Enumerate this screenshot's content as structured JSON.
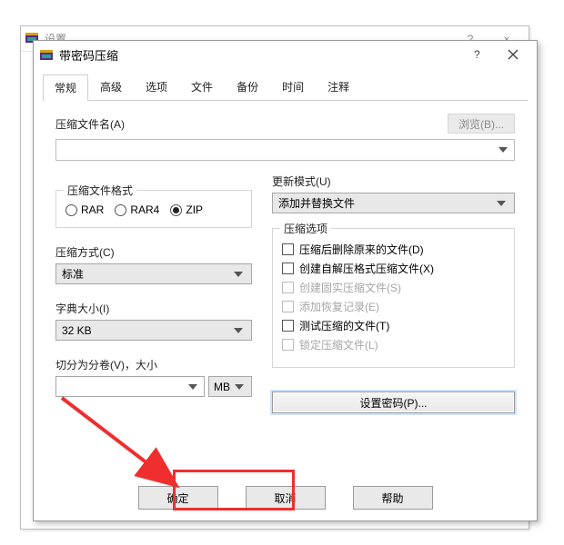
{
  "bg_window": {
    "title": "设置",
    "help": "?",
    "close": "×"
  },
  "dialog": {
    "title": "带密码压缩",
    "help": "?",
    "close": "×",
    "tabs": [
      "常规",
      "高级",
      "选项",
      "文件",
      "备份",
      "时间",
      "注释"
    ],
    "active_tab": 0,
    "archive_label": "压缩文件名(A)",
    "browse": "浏览(B)...",
    "archive_value": "",
    "update_mode_label": "更新模式(U)",
    "update_mode_value": "添加并替换文件",
    "format_group": "压缩文件格式",
    "formats": [
      {
        "label": "RAR",
        "checked": false
      },
      {
        "label": "RAR4",
        "checked": false
      },
      {
        "label": "ZIP",
        "checked": true
      }
    ],
    "method_label": "压缩方式(C)",
    "method_value": "标准",
    "dict_label": "字典大小(I)",
    "dict_value": "32 KB",
    "split_label": "切分为分卷(V)，大小",
    "split_value": "",
    "split_unit": "MB",
    "options_group": "压缩选项",
    "options": [
      {
        "label": "压缩后删除原来的文件(D)",
        "checked": false,
        "disabled": false
      },
      {
        "label": "创建自解压格式压缩文件(X)",
        "checked": false,
        "disabled": false
      },
      {
        "label": "创建固实压缩文件(S)",
        "checked": false,
        "disabled": true
      },
      {
        "label": "添加恢复记录(E)",
        "checked": false,
        "disabled": true
      },
      {
        "label": "测试压缩的文件(T)",
        "checked": false,
        "disabled": false
      },
      {
        "label": "锁定压缩文件(L)",
        "checked": false,
        "disabled": true
      }
    ],
    "set_password": "设置密码(P)...",
    "ok": "确定",
    "cancel": "取消",
    "help_btn": "帮助"
  }
}
